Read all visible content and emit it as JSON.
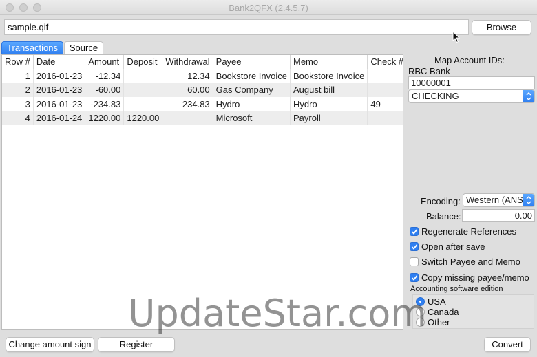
{
  "window": {
    "title": "Bank2QFX (2.4.5.7)"
  },
  "file": {
    "value": "sample.qif",
    "browse_label": "Browse"
  },
  "tabs": [
    {
      "label": "Transactions",
      "active": true
    },
    {
      "label": "Source",
      "active": false
    }
  ],
  "table": {
    "columns": [
      "Row #",
      "Date",
      "Amount",
      "Deposit",
      "Withdrawal",
      "Payee",
      "Memo",
      "Check #"
    ],
    "rows": [
      [
        "1",
        "2016-01-23",
        "-12.34",
        "",
        "12.34",
        "Bookstore Invoice",
        "Bookstore Invoice",
        ""
      ],
      [
        "2",
        "2016-01-23",
        "-60.00",
        "",
        "60.00",
        "Gas Company",
        "August bill",
        ""
      ],
      [
        "3",
        "2016-01-23",
        "-234.83",
        "",
        "234.83",
        "Hydro",
        "Hydro",
        "49"
      ],
      [
        "4",
        "2016-01-24",
        "1220.00",
        "1220.00",
        "",
        "Microsoft",
        "Payroll",
        ""
      ]
    ]
  },
  "settings": {
    "map_label": "Map Account IDs:",
    "bank_label": "RBC Bank",
    "account_id": "10000001",
    "account_type": "CHECKING",
    "encoding_label": "Encoding:",
    "encoding_value": "Western (ANSI)",
    "balance_label": "Balance:",
    "balance_value": "0.00",
    "checkboxes": [
      {
        "label": "Regenerate References",
        "checked": true
      },
      {
        "label": "Open after save",
        "checked": true
      },
      {
        "label": "Switch Payee and Memo",
        "checked": false
      },
      {
        "label": "Copy missing payee/memo",
        "checked": true
      }
    ],
    "edition_label": "Accounting software edition",
    "editions": [
      {
        "label": "USA",
        "selected": true
      },
      {
        "label": "Canada",
        "selected": false
      },
      {
        "label": "Other",
        "selected": false
      }
    ]
  },
  "footer": {
    "change_sign_label": "Change amount sign",
    "register_label": "Register",
    "convert_label": "Convert"
  },
  "watermark": "UpdateStar.com",
  "colors": {
    "accent": "#2f7ff0",
    "window_bg": "#dedede",
    "row_alt": "#ededed"
  }
}
